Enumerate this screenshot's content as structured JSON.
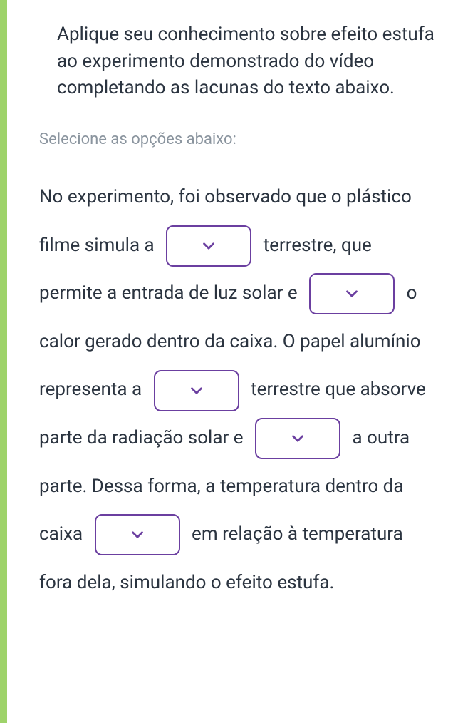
{
  "question": {
    "prompt": "Aplique seu conhecimento sobre efeito estufa ao experimento demonstrado do vídeo completando as lacunas do texto abaixo.",
    "sub_instruction": "Selecione as opções abaixo:"
  },
  "fill_in": {
    "seg1": "No experimento, foi observado que o plástico filme simula a",
    "seg2": "terrestre, que permite a entrada de luz solar e",
    "seg3": "o calor gerado dentro da caixa. O papel alumínio representa a",
    "seg4": "terrestre que absorve parte da radiação solar e",
    "seg5": "a outra parte. Dessa forma, a temperatura dentro da caixa",
    "seg6": "em relação à temperatura fora dela, simulando o efeito estufa."
  },
  "dropdowns": {
    "blank1": "",
    "blank2": "",
    "blank3": "",
    "blank4": "",
    "blank5": ""
  }
}
